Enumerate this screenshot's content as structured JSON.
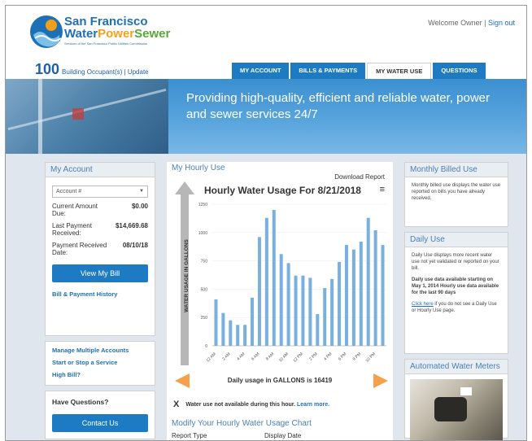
{
  "brand": {
    "line1": "San Francisco",
    "line2a": "Water",
    "line2b": "Power",
    "line2c": "Sewer",
    "tagline": "Services of the San Francisco Public Utilities Commission"
  },
  "welcome": {
    "text": "Welcome Owner",
    "signout": "Sign out"
  },
  "occupants": {
    "count": "100",
    "label": "Building Occupant(s) | Update"
  },
  "tabs": [
    "MY ACCOUNT",
    "BILLS & PAYMENTS",
    "MY WATER USE",
    "QUESTIONS"
  ],
  "banner": {
    "text": "Providing high-quality, efficient and reliable water, power and sewer services 24/7"
  },
  "account": {
    "header": "My Account",
    "select": "Account #",
    "current_label": "Current Amount Due:",
    "current_value": "$0.00",
    "last_label": "Last Payment Received:",
    "last_value": "$14,669.68",
    "date_label": "Payment Received Date:",
    "date_value": "08/10/18",
    "view_bill": "View My Bill",
    "history": "Bill & Payment History"
  },
  "links": {
    "manage": "Manage Multiple Accounts",
    "startstop": "Start or Stop a Service",
    "highbill": "High Bill?"
  },
  "questions": {
    "header": "Have Questions?",
    "contact": "Contact Us"
  },
  "hourly": {
    "header": "My Hourly Use",
    "download": "Download Report",
    "daily_text": "Daily usage in GALLONS is 16419",
    "x_mark": "X",
    "unavailable": "Water use not available during this hour.",
    "learn": "Learn more.",
    "modify": "Modify Your Hourly Water Usage Chart",
    "report_type": "Report Type",
    "display_date": "Display Date"
  },
  "chart_data": {
    "type": "bar",
    "title": "Hourly Water Usage For 8/21/2018",
    "ylabel": "WATER USAGE IN GALLONS",
    "ylim": [
      0,
      1250
    ],
    "yticks": [
      0,
      250,
      500,
      750,
      1000,
      1250
    ],
    "categories": [
      "12 AM",
      "1 AM",
      "2 AM",
      "3 AM",
      "4 AM",
      "5 AM",
      "6 AM",
      "7 AM",
      "8 AM",
      "9 AM",
      "10 AM",
      "11 AM",
      "12 PM",
      "1 PM",
      "2 PM",
      "3 PM",
      "4 PM",
      "5 PM",
      "6 PM",
      "7 PM",
      "8 PM",
      "9 PM",
      "10 PM",
      "11 PM"
    ],
    "xlabels": [
      "12 AM",
      "2 AM",
      "4 AM",
      "6 AM",
      "8 AM",
      "10 AM",
      "12 PM",
      "2 PM",
      "4 PM",
      "6 PM",
      "8 PM",
      "10 PM"
    ],
    "values": [
      410,
      290,
      225,
      185,
      185,
      425,
      960,
      1130,
      1200,
      810,
      730,
      620,
      620,
      600,
      280,
      510,
      590,
      740,
      890,
      850,
      920,
      1130,
      1020,
      890
    ],
    "color": "#7ab0e0"
  },
  "monthly": {
    "header": "Monthly Billed Use",
    "text": "Monthly billed use displays the water use reported on bills you have already received."
  },
  "daily": {
    "header": "Daily Use",
    "text": "Daily Use displays more recent water use not yet validated or reported on your bill.",
    "bold": "Daily use data available starting on May 1, 2014 Hourly use data available for the last 90 days",
    "link": "Click here",
    "link_tail": "if you do not see a Daily Use or Hourly Use page."
  },
  "meters": {
    "header": "Automated Water Meters"
  },
  "colors": {
    "primary": "#1d7bc4",
    "orange": "#f5a04a"
  }
}
